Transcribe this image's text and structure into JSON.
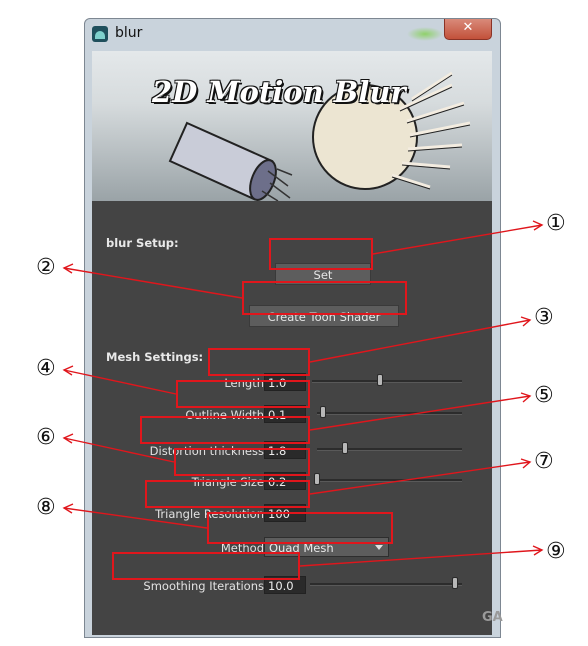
{
  "window": {
    "title": "blur",
    "close_glyph": "✕",
    "icon": "maya-app-icon"
  },
  "banner": {
    "logo_text": "2D Motion Blur"
  },
  "setup": {
    "section_label": "blur Setup:",
    "set_button": "Set",
    "toon_button": "Create Toon Shader"
  },
  "mesh": {
    "section_label": "Mesh Settings:",
    "length": {
      "label": "Length",
      "value": "1.0",
      "slider_fraction": 0.45
    },
    "outline_width": {
      "label": "Outline Width",
      "value": "0.1",
      "slider_fraction": 0.02
    },
    "distortion": {
      "label": "Distortion thickness",
      "value": "1.8",
      "slider_fraction": 0.18
    },
    "triangle_size": {
      "label": "Triangle Size",
      "value": "0.2",
      "slider_fraction": 0.0
    },
    "triangle_resolution": {
      "label": "Triangle Resolution",
      "value": "100"
    },
    "method": {
      "label": "Method",
      "value": "Quad Mesh"
    },
    "smoothing": {
      "label": "Smoothing Iterations",
      "value": "10.0",
      "slider_fraction": 0.97
    }
  },
  "annotations": {
    "color": "#e0161c",
    "markers": [
      "①",
      "②",
      "③",
      "④",
      "⑤",
      "⑥",
      "⑦",
      "⑧",
      "⑨"
    ]
  },
  "watermark": "GA"
}
